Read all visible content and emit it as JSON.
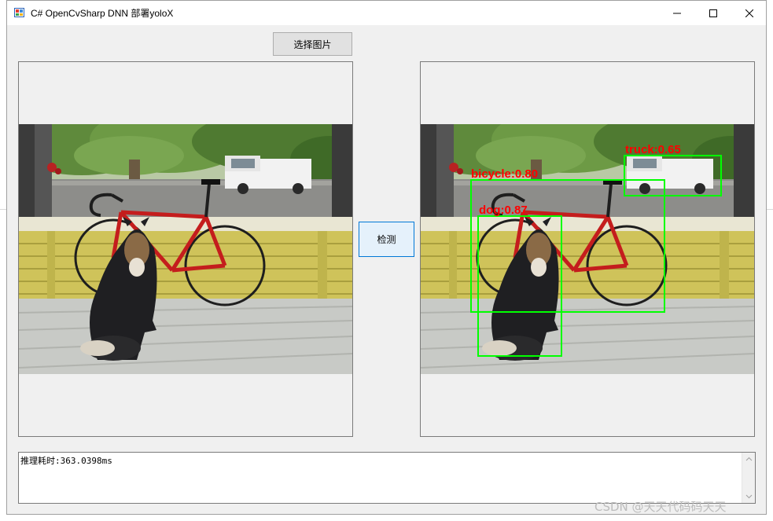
{
  "window": {
    "title": "C# OpenCvSharp DNN 部署yoloX",
    "icon": "app-window-icon",
    "controls": [
      "minimize-icon",
      "maximize-icon",
      "close-icon"
    ]
  },
  "toolbar": {
    "select_image_label": "选择图片",
    "detect_label": "检测"
  },
  "left_picture": {
    "content": "bicycle-dog-photo"
  },
  "right_picture": {
    "content": "bicycle-dog-photo-with-detections",
    "detections": [
      {
        "label": "truck:0.65",
        "color": "#00ff00"
      },
      {
        "label": "bicycle:0.80",
        "color": "#00ff00"
      },
      {
        "label": "dog:0.87",
        "color": "#00ff00"
      }
    ],
    "label_color": "#ff0000"
  },
  "output": {
    "text": "推理耗时:363.0398ms"
  },
  "watermark": {
    "text": "CSDN @天天代码码天天"
  }
}
